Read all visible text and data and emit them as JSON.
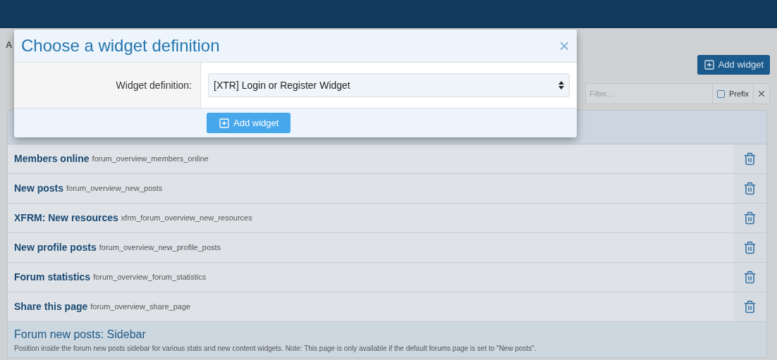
{
  "page": {
    "breadcrumb": "A",
    "add_button": "Add widget",
    "filter": {
      "placeholder": "Filter...",
      "prefix": {
        "label": "Prefix",
        "checked": false
      }
    },
    "widgets": [
      {
        "title": "Members online",
        "key": "forum_overview_members_online"
      },
      {
        "title": "New posts",
        "key": "forum_overview_new_posts"
      },
      {
        "title": "XFRM: New resources",
        "key": "xfrm_forum_overview_new_resources"
      },
      {
        "title": "New profile posts",
        "key": "forum_overview_new_profile_posts"
      },
      {
        "title": "Forum statistics",
        "key": "forum_overview_forum_statistics"
      },
      {
        "title": "Share this page",
        "key": "forum_overview_share_page"
      }
    ],
    "section": {
      "title": "Forum new posts: Sidebar",
      "description": "Position inside the forum new posts sidebar for various stats and new content widgets. Note: This page is only available if the default forums page is set to \"New posts\"."
    }
  },
  "dialog": {
    "title": "Choose a widget definition",
    "close": "×",
    "field_label": "Widget definition:",
    "field_value": "[XTR] Login or Register Widget",
    "submit": "Add widget"
  }
}
